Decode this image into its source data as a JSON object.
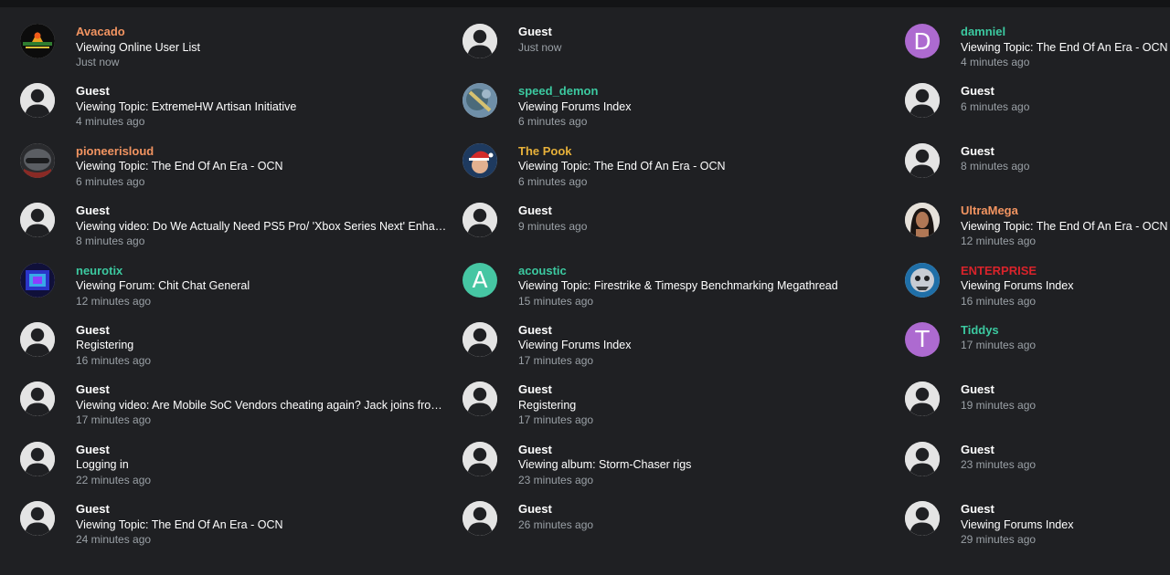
{
  "colors": {
    "background": "#1f2023",
    "top_bar": "#131416",
    "guest_name": "#ffffff",
    "orange_user": "#f29461",
    "green_user": "#3cc9a0",
    "gold_user": "#e7b13a",
    "red_user": "#d9232b",
    "purple_avatar": "#ad6ad0",
    "teal_avatar": "#46c6a3",
    "time_text": "#9aa0a6"
  },
  "columns": [
    {
      "users": [
        {
          "name": "Avacado",
          "name_color": "#f29461",
          "avatar": "image-avacado",
          "activity": "Viewing Online User List",
          "time": "Just now"
        },
        {
          "name": "Guest",
          "name_color": "#ffffff",
          "avatar": "guest-silhouette",
          "activity": "Viewing Topic: ExtremeHW Artisan Initiative",
          "time": "4 minutes ago"
        },
        {
          "name": "pioneerisloud",
          "name_color": "#f29461",
          "avatar": "image-pioneerisloud",
          "activity": "Viewing Topic: The End Of An Era - OCN",
          "time": "6 minutes ago"
        },
        {
          "name": "Guest",
          "name_color": "#ffffff",
          "avatar": "guest-silhouette",
          "activity": "Viewing video: Do We Actually Need PS5 Pro/ 'Xbox Series Next' Enhan...",
          "time": "8 minutes ago"
        },
        {
          "name": "neurotix",
          "name_color": "#3cc9a0",
          "avatar": "image-neurotix",
          "activity": "Viewing Forum: Chit Chat General",
          "time": "12 minutes ago"
        },
        {
          "name": "Guest",
          "name_color": "#ffffff",
          "avatar": "guest-silhouette",
          "activity": "Registering",
          "time": "16 minutes ago"
        },
        {
          "name": "Guest",
          "name_color": "#ffffff",
          "avatar": "guest-silhouette",
          "activity": "Viewing video: Are Mobile SoC Vendors cheating again? Jack joins from...",
          "time": "17 minutes ago"
        },
        {
          "name": "Guest",
          "name_color": "#ffffff",
          "avatar": "guest-silhouette",
          "activity": "Logging in",
          "time": "22 minutes ago"
        },
        {
          "name": "Guest",
          "name_color": "#ffffff",
          "avatar": "guest-silhouette",
          "activity": "Viewing Topic: The End Of An Era - OCN",
          "time": "24 minutes ago"
        }
      ]
    },
    {
      "users": [
        {
          "name": "Guest",
          "name_color": "#ffffff",
          "avatar": "guest-silhouette",
          "activity": "",
          "time": "Just now"
        },
        {
          "name": "speed_demon",
          "name_color": "#3cc9a0",
          "avatar": "image-speed-demon",
          "activity": "Viewing Forums Index",
          "time": "6 minutes ago"
        },
        {
          "name": "The Pook",
          "name_color": "#e7b13a",
          "avatar": "image-the-pook",
          "activity": "Viewing Topic: The End Of An Era - OCN",
          "time": "6 minutes ago"
        },
        {
          "name": "Guest",
          "name_color": "#ffffff",
          "avatar": "guest-silhouette",
          "activity": "",
          "time": "9 minutes ago"
        },
        {
          "name": "acoustic",
          "name_color": "#3cc9a0",
          "avatar": "letter",
          "avatar_letter": "A",
          "avatar_color": "#46c6a3",
          "activity": "Viewing Topic: Firestrike & Timespy Benchmarking Megathread",
          "time": "15 minutes ago"
        },
        {
          "name": "Guest",
          "name_color": "#ffffff",
          "avatar": "guest-silhouette",
          "activity": "Viewing Forums Index",
          "time": "17 minutes ago"
        },
        {
          "name": "Guest",
          "name_color": "#ffffff",
          "avatar": "guest-silhouette",
          "activity": "Registering",
          "time": "17 minutes ago"
        },
        {
          "name": "Guest",
          "name_color": "#ffffff",
          "avatar": "guest-silhouette",
          "activity": "Viewing album: Storm-Chaser rigs",
          "time": "23 minutes ago"
        },
        {
          "name": "Guest",
          "name_color": "#ffffff",
          "avatar": "guest-silhouette",
          "activity": "",
          "time": "26 minutes ago"
        }
      ]
    },
    {
      "users": [
        {
          "name": "damniel",
          "name_color": "#3cc9a0",
          "avatar": "letter",
          "avatar_letter": "D",
          "avatar_color": "#ad6ad0",
          "activity": "Viewing Topic: The End Of An Era - OCN",
          "time": "4 minutes ago"
        },
        {
          "name": "Guest",
          "name_color": "#ffffff",
          "avatar": "guest-silhouette",
          "activity": "",
          "time": "6 minutes ago"
        },
        {
          "name": "Guest",
          "name_color": "#ffffff",
          "avatar": "guest-silhouette",
          "activity": "",
          "time": "8 minutes ago"
        },
        {
          "name": "UltraMega",
          "name_color": "#f29461",
          "avatar": "image-ultramega",
          "activity": "Viewing Topic: The End Of An Era - OCN",
          "time": "12 minutes ago"
        },
        {
          "name": "ENTERPRISE",
          "name_color": "#d9232b",
          "avatar": "image-enterprise",
          "activity": "Viewing Forums Index",
          "time": "16 minutes ago"
        },
        {
          "name": "Tiddys",
          "name_color": "#3cc9a0",
          "avatar": "letter",
          "avatar_letter": "T",
          "avatar_color": "#ad6ad0",
          "activity": "",
          "time": "17 minutes ago"
        },
        {
          "name": "Guest",
          "name_color": "#ffffff",
          "avatar": "guest-silhouette",
          "activity": "",
          "time": "19 minutes ago"
        },
        {
          "name": "Guest",
          "name_color": "#ffffff",
          "avatar": "guest-silhouette",
          "activity": "",
          "time": "23 minutes ago"
        },
        {
          "name": "Guest",
          "name_color": "#ffffff",
          "avatar": "guest-silhouette",
          "activity": "Viewing Forums Index",
          "time": "29 minutes ago"
        }
      ]
    }
  ]
}
